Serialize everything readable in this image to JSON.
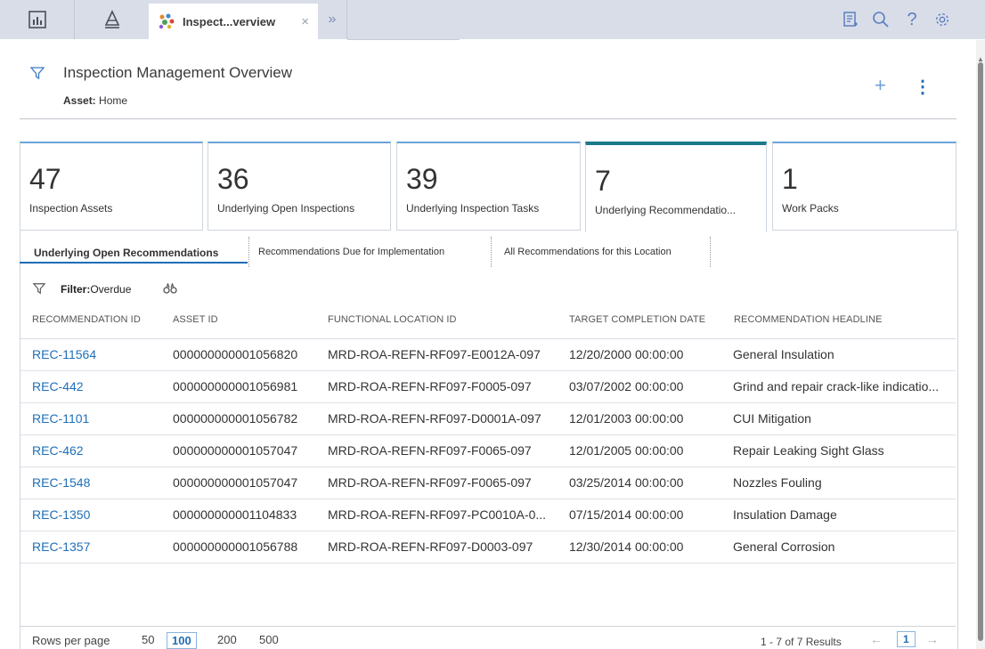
{
  "topbar": {
    "tab_label": "Inspect...verview",
    "tab_close": "×",
    "overflow_chevron": "»",
    "icons": [
      "dashboard-icon",
      "asset-hierarchy-icon",
      "app-tab-icon",
      "notes-icon",
      "search-icon",
      "help-icon",
      "settings-icon"
    ]
  },
  "header": {
    "title": "Inspection Management Overview",
    "asset_label": "Asset:",
    "asset_value": "Home",
    "add_label": "+",
    "menu_label": "⋮"
  },
  "kpis": [
    {
      "value": "47",
      "label": "Inspection Assets"
    },
    {
      "value": "36",
      "label": "Underlying Open Inspections"
    },
    {
      "value": "39",
      "label": "Underlying Inspection Tasks"
    },
    {
      "value": "7",
      "label": "Underlying Recommendatio..."
    },
    {
      "value": "1",
      "label": "Work Packs"
    }
  ],
  "subtabs": [
    {
      "label": "Underlying Open Recommendations"
    },
    {
      "label": "Recommendations Due for Implementation"
    },
    {
      "label": "All Recommendations for this Location"
    }
  ],
  "filter": {
    "label": "Filter:",
    "value": "Overdue"
  },
  "table": {
    "columns": [
      "RECOMMENDATION ID",
      "ASSET ID",
      "FUNCTIONAL LOCATION ID",
      "TARGET COMPLETION DATE",
      "RECOMMENDATION HEADLINE"
    ],
    "rows": [
      [
        "REC-11564",
        "000000000001056820",
        "MRD-ROA-REFN-RF097-E0012A-097",
        "12/20/2000 00:00:00",
        "General Insulation"
      ],
      [
        "REC-442",
        "000000000001056981",
        "MRD-ROA-REFN-RF097-F0005-097",
        "03/07/2002 00:00:00",
        "Grind and repair crack-like indicatio..."
      ],
      [
        "REC-1101",
        "000000000001056782",
        "MRD-ROA-REFN-RF097-D0001A-097",
        "12/01/2003 00:00:00",
        "CUI Mitigation"
      ],
      [
        "REC-462",
        "000000000001057047",
        "MRD-ROA-REFN-RF097-F0065-097",
        "12/01/2005 00:00:00",
        "Repair Leaking Sight Glass"
      ],
      [
        "REC-1548",
        "000000000001057047",
        "MRD-ROA-REFN-RF097-F0065-097",
        "03/25/2014 00:00:00",
        "Nozzles Fouling"
      ],
      [
        "REC-1350",
        "000000000001104833",
        "MRD-ROA-REFN-RF097-PC0010A-0...",
        "07/15/2014 00:00:00",
        "Insulation Damage"
      ],
      [
        "REC-1357",
        "000000000001056788",
        "MRD-ROA-REFN-RF097-D0003-097",
        "12/30/2014 00:00:00",
        "General Corrosion"
      ]
    ]
  },
  "footer": {
    "rows_per_page_label": "Rows per page",
    "options": [
      "50",
      "100",
      "200",
      "500"
    ],
    "selected_option": "100",
    "results": "1 - 7 of 7 Results",
    "prev": "←",
    "page": "1",
    "next": "→"
  },
  "colors": {
    "link": "#1e6fba",
    "active_kpi": "#1a7a8c",
    "kpi_top": "#6aa3d8",
    "topbar": "#d9dde8"
  }
}
